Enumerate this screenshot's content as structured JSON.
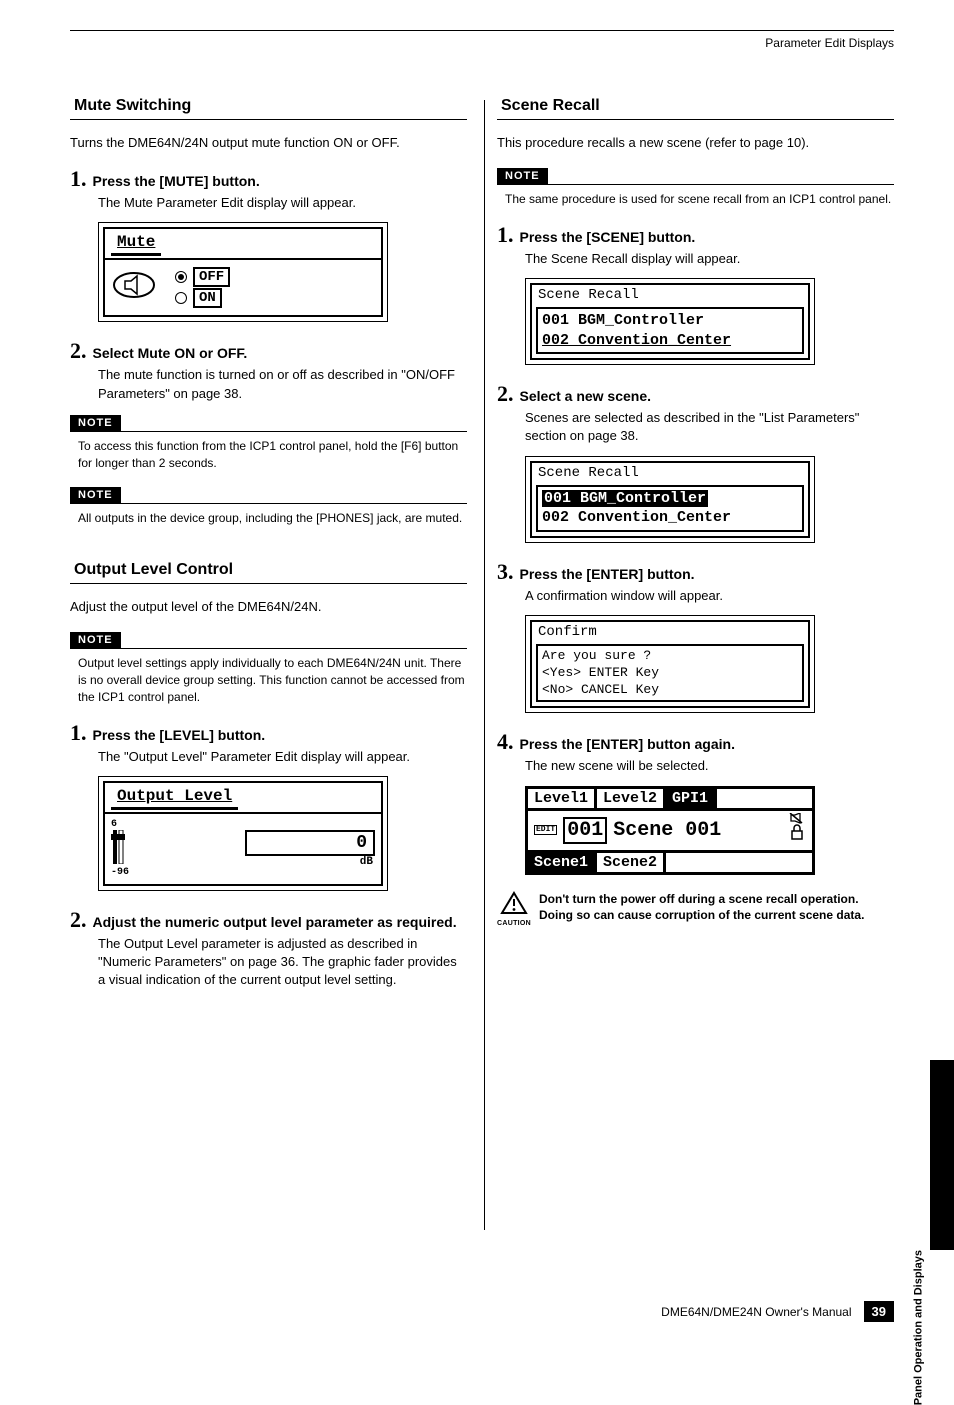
{
  "running_head": "Parameter Edit Displays",
  "left": {
    "mute": {
      "title": "Mute Switching",
      "intro": "Turns the DME64N/24N output mute function ON or OFF.",
      "step1_num": "1.",
      "step1_title": "Press the [MUTE] button.",
      "step1_body": "The Mute Parameter Edit display will appear.",
      "lcd_title": "Mute",
      "opt_off": "OFF",
      "opt_on": "ON",
      "step2_num": "2.",
      "step2_title": "Select Mute ON or OFF.",
      "step2_body": "The mute function is turned on or off as described in \"ON/OFF Parameters\" on page 38.",
      "note_label": "NOTE",
      "note1": "To access this function from the ICP1 control panel, hold the [F6] button for longer than 2 seconds.",
      "note2": "All outputs in the device group, including the [PHONES] jack, are muted."
    },
    "output": {
      "title": "Output Level Control",
      "intro": "Adjust the output level of the DME64N/24N.",
      "note_label": "NOTE",
      "note1": "Output level settings apply individually to each DME64N/24N unit. There is no overall device group setting. This function cannot be accessed from the ICP1 control panel.",
      "step1_num": "1.",
      "step1_title": "Press the [LEVEL] button.",
      "step1_body": "The \"Output Level\" Parameter Edit display will appear.",
      "lcd_title": "Output Level",
      "fader_top": "6",
      "fader_bot": "-96",
      "value": "0",
      "unit": "dB",
      "step2_num": "2.",
      "step2_title": "Adjust the numeric output level parameter as required.",
      "step2_body": "The Output Level parameter is adjusted as described in \"Numeric Parameters\" on page 36. The graphic fader provides a visual indication of the current output level setting."
    }
  },
  "right": {
    "scene": {
      "title": "Scene Recall",
      "intro": "This procedure recalls a new scene (refer to page 10).",
      "note_label": "NOTE",
      "note1": "The same procedure is used for scene recall from an ICP1 control panel.",
      "step1_num": "1.",
      "step1_title": "Press the [SCENE] button.",
      "step1_body": "The Scene Recall display will appear.",
      "lcd1_title": "Scene Recall",
      "row1": "001 BGM_Controller",
      "row2": "002 Convention_Center",
      "step2_num": "2.",
      "step2_title": "Select a new scene.",
      "step2_body": "Scenes are selected as described in the \"List Parameters\" section on page 38.",
      "step3_num": "3.",
      "step3_title": "Press the [ENTER] button.",
      "step3_body": "A confirmation window will appear.",
      "confirm_title": "Confirm",
      "confirm_l1": "Are you sure ?",
      "confirm_l2": "<Yes> ENTER Key",
      "confirm_l3": "<No>  CANCEL Key",
      "step4_num": "4.",
      "step4_title": "Press the [ENTER] button again.",
      "step4_body": "The new scene will be selected.",
      "main_tab1": "Level1",
      "main_tab2": "Level2",
      "main_tab3": "GPI1",
      "edit_tag": "EDIT",
      "main_scene_num": "001",
      "main_scene": "Scene 001",
      "main_btab1": "Scene1",
      "main_btab2": "Scene2",
      "caution_label": "CAUTION",
      "caution_text": "Don't turn the power off during a scene recall operation. Doing so can cause corruption of the current scene data."
    }
  },
  "side_tab": "Panel Operation and Displays",
  "footer_manual": "DME64N/DME24N Owner's Manual",
  "footer_page": "39"
}
